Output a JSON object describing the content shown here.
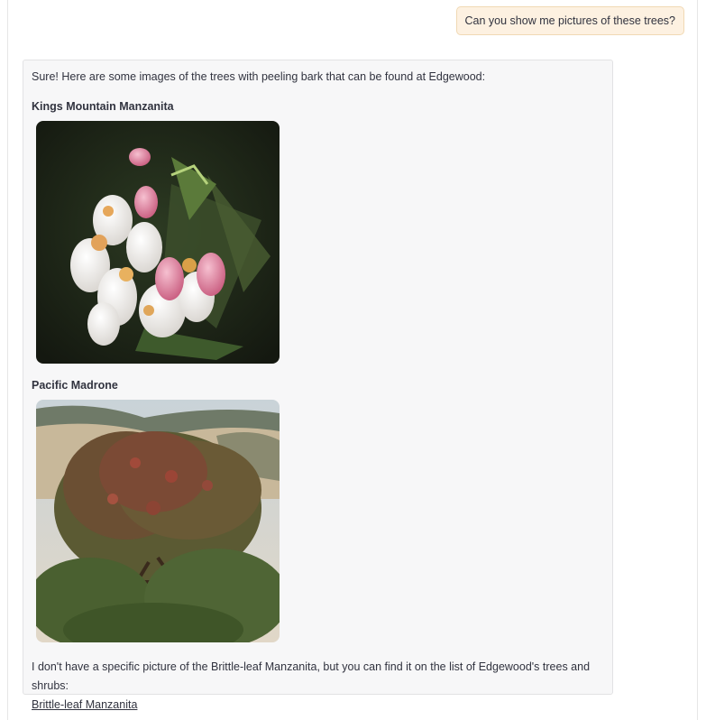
{
  "conversation": {
    "user_message": "Can you show me pictures of these trees?",
    "assistant": {
      "intro": "Sure! Here are some images of the trees with peeling bark that can be found at Edgewood:",
      "items": [
        {
          "title": "Kings Mountain Manzanita",
          "image_icon": "manzanita-flower-photo"
        },
        {
          "title": "Pacific Madrone",
          "image_icon": "madrone-tree-photo"
        }
      ],
      "closing_text": "I don't have a specific picture of the Brittle-leaf Manzanita, but you can find it on the list of Edgewood's trees and shrubs:",
      "link_text": "Brittle-leaf Manzanita"
    }
  }
}
